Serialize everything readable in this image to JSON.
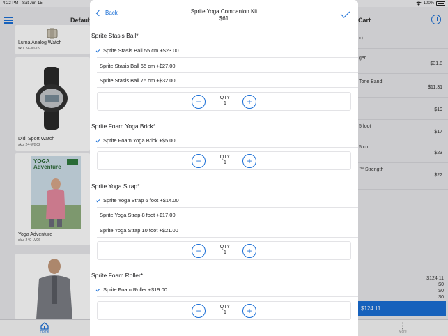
{
  "status_bar": {
    "time": "4:22 PM",
    "date": "Sat Jun 15",
    "battery": "100%"
  },
  "background": {
    "header": {
      "title": "Default"
    },
    "products": [
      {
        "name": "Luma Analog Watch",
        "sku": "sku: 24-WG09"
      },
      {
        "name": "Didi Sport Watch",
        "sku": "sku: 24-WG02"
      },
      {
        "name": "Yoga Adventure",
        "sku": "sku: 240-LV06"
      }
    ],
    "dvd_title": "YOGA Adventure",
    "cart": {
      "title": "Cart",
      "items": [
        {
          "label": "o )",
          "price": ""
        },
        {
          "label": "ger",
          "price": "$31.8"
        },
        {
          "label": "Tone Band",
          "price": "$11.31"
        },
        {
          "label": "",
          "price": "$19"
        },
        {
          "label": "5 foot",
          "price": "$17"
        },
        {
          "label": "5 cm",
          "price": "$23"
        },
        {
          "label": "™ Strength",
          "price": "$22"
        }
      ],
      "totals": [
        "$124.11",
        "$0",
        "$0",
        "$0"
      ],
      "pay_label": "$124.11"
    },
    "tabs": {
      "home": "Home",
      "more": "More"
    }
  },
  "modal": {
    "back_label": "Back",
    "title": "Sprite Yoga Companion Kit",
    "price": "$61",
    "qty_label": "QTY",
    "sections": [
      {
        "title": "Sprite Stasis Ball*",
        "options": [
          {
            "label": "Sprite Stasis Ball 55 cm +$23.00",
            "selected": true
          },
          {
            "label": "Sprite Stasis Ball 65 cm +$27.00",
            "selected": false
          },
          {
            "label": "Sprite Stasis Ball 75 cm +$32.00",
            "selected": false
          }
        ],
        "qty": "1"
      },
      {
        "title": "Sprite Foam Yoga Brick*",
        "options": [
          {
            "label": "Sprite Foam Yoga Brick +$5.00",
            "selected": true
          }
        ],
        "qty": "1"
      },
      {
        "title": "Sprite Yoga Strap*",
        "options": [
          {
            "label": "Sprite Yoga Strap 6 foot +$14.00",
            "selected": true
          },
          {
            "label": "Sprite Yoga Strap 8 foot +$17.00",
            "selected": false
          },
          {
            "label": "Sprite Yoga Strap 10 foot +$21.00",
            "selected": false
          }
        ],
        "qty": "1"
      },
      {
        "title": "Sprite Foam Roller*",
        "options": [
          {
            "label": "Sprite Foam Roller +$19.00",
            "selected": true
          }
        ],
        "qty": "1"
      }
    ]
  },
  "colors": {
    "accent": "#1a6fd6"
  }
}
